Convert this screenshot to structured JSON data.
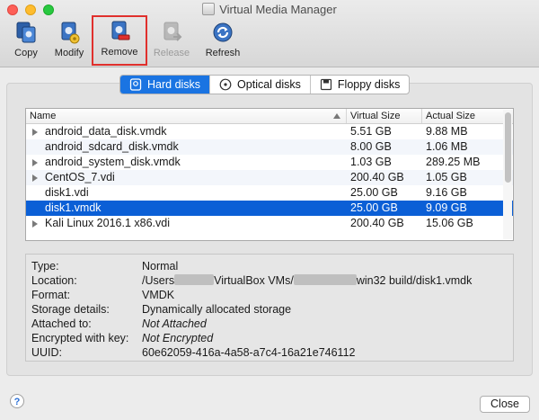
{
  "window": {
    "title": "Virtual Media Manager"
  },
  "toolbar": {
    "copy": "Copy",
    "modify": "Modify",
    "remove": "Remove",
    "release": "Release",
    "refresh": "Refresh"
  },
  "tabs": [
    {
      "label": "Hard disks",
      "icon": "hard-disk-icon",
      "active": true
    },
    {
      "label": "Optical disks",
      "icon": "optical-disk-icon",
      "active": false
    },
    {
      "label": "Floppy disks",
      "icon": "floppy-disk-icon",
      "active": false
    }
  ],
  "table": {
    "columns": [
      "Name",
      "Virtual Size",
      "Actual Size"
    ],
    "rows": [
      {
        "name": "android_data_disk.vmdk",
        "virtual": "5.51 GB",
        "actual": "9.88 MB",
        "expandable": true
      },
      {
        "name": "android_sdcard_disk.vmdk",
        "virtual": "8.00 GB",
        "actual": "1.06 MB",
        "expandable": false
      },
      {
        "name": "android_system_disk.vmdk",
        "virtual": "1.03 GB",
        "actual": "289.25 MB",
        "expandable": true
      },
      {
        "name": "CentOS_7.vdi",
        "virtual": "200.40 GB",
        "actual": "1.05 GB",
        "expandable": true
      },
      {
        "name": "disk1.vdi",
        "virtual": "25.00 GB",
        "actual": "9.16 GB",
        "expandable": false
      },
      {
        "name": "disk1.vmdk",
        "virtual": "25.00 GB",
        "actual": "9.09 GB",
        "expandable": false,
        "selected": true
      },
      {
        "name": "Kali Linux 2016.1 x86.vdi",
        "virtual": "200.40 GB",
        "actual": "15.06 GB",
        "expandable": true
      }
    ]
  },
  "details": {
    "type_label": "Type:",
    "type_value": "Normal",
    "location_label": "Location:",
    "location_part1": "/Users",
    "location_part2": "VirtualBox VMs/",
    "location_part3": "win32 build/disk1.vmdk",
    "format_label": "Format:",
    "format_value": "VMDK",
    "storage_label": "Storage details:",
    "storage_value": "Dynamically allocated storage",
    "attached_label": "Attached to:",
    "attached_value": "Not Attached",
    "encrypted_label": "Encrypted with key:",
    "encrypted_value": "Not Encrypted",
    "uuid_label": "UUID:",
    "uuid_value": "60e62059-416a-4a58-a7c4-16a21e746112"
  },
  "footer": {
    "help": "?",
    "close": "Close"
  },
  "colors": {
    "accent": "#1a74e2",
    "selection": "#0b5fd6",
    "highlight_box": "#e0302d"
  }
}
